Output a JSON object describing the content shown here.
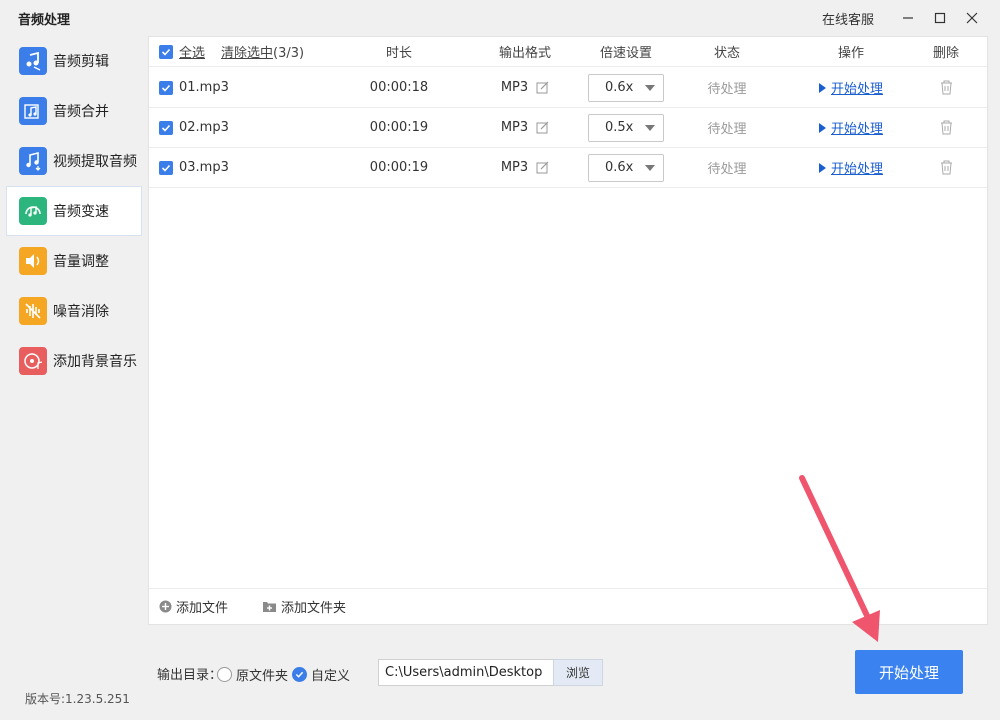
{
  "window": {
    "title": "音频处理",
    "service_label": "在线客服"
  },
  "sidebar": {
    "items": [
      {
        "label": "音频剪辑",
        "icon": "audio-cut-icon",
        "color": "#3b7de9"
      },
      {
        "label": "音频合并",
        "icon": "audio-merge-icon",
        "color": "#3b7de9"
      },
      {
        "label": "视频提取音频",
        "icon": "video-extract-audio-icon",
        "color": "#3b7de9"
      },
      {
        "label": "音频变速",
        "icon": "audio-speed-icon",
        "color": "#2cb67d"
      },
      {
        "label": "音量调整",
        "icon": "volume-icon",
        "color": "#f5a623"
      },
      {
        "label": "噪音消除",
        "icon": "noise-reduction-icon",
        "color": "#f5a623"
      },
      {
        "label": "添加背景音乐",
        "icon": "background-music-icon",
        "color": "#e85d5d"
      }
    ],
    "active_index": 3
  },
  "table": {
    "select_all": "全选",
    "clear_selected": "清除选中",
    "selected_count": "(3/3)",
    "headers": {
      "duration": "时长",
      "format": "输出格式",
      "speed": "倍速设置",
      "status": "状态",
      "action": "操作",
      "delete": "删除"
    },
    "rows": [
      {
        "name": "01.mp3",
        "duration": "00:00:18",
        "format": "MP3",
        "speed": "0.6x",
        "status": "待处理",
        "action": "开始处理",
        "checked": true
      },
      {
        "name": "02.mp3",
        "duration": "00:00:19",
        "format": "MP3",
        "speed": "0.5x",
        "status": "待处理",
        "action": "开始处理",
        "checked": true
      },
      {
        "name": "03.mp3",
        "duration": "00:00:19",
        "format": "MP3",
        "speed": "0.6x",
        "status": "待处理",
        "action": "开始处理",
        "checked": true
      }
    ],
    "footer": {
      "add_file": "添加文件",
      "add_folder": "添加文件夹"
    }
  },
  "output": {
    "label": "输出目录：",
    "option_original": "原文件夹",
    "option_custom": "自定义",
    "selected": "custom",
    "path": "C:\\Users\\admin\\Desktop",
    "browse": "浏览"
  },
  "start_button": "开始处理",
  "version": "版本号:1.23.5.251",
  "colors": {
    "accent": "#3a82f0",
    "link": "#1a5fd0",
    "arrow": "#f0556e"
  }
}
